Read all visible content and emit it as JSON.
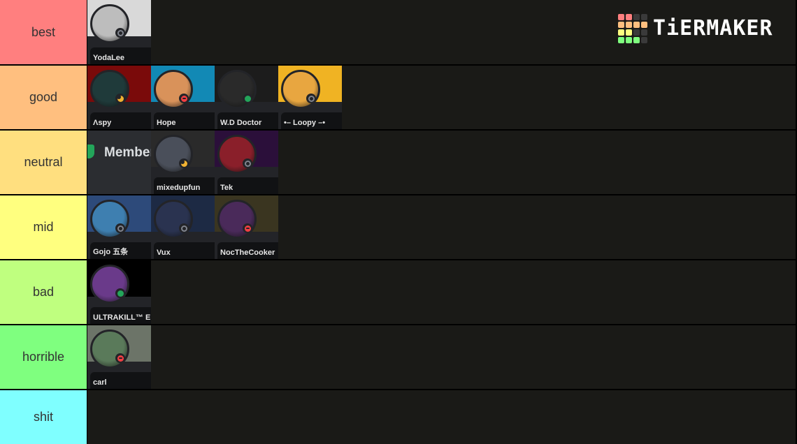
{
  "logo": {
    "text": "TiERMAKER",
    "grid_colors": [
      "#ff7f7f",
      "#ff7f7f",
      "#3a3a3a",
      "#3a3a3a",
      "#ffbf7f",
      "#ffbf7f",
      "#ffbf7f",
      "#ffbf7f",
      "#ffff7f",
      "#ffff7f",
      "#3a3a3a",
      "#3a3a3a",
      "#7fff7f",
      "#7fff7f",
      "#7fff7f",
      "#3a3a3a"
    ]
  },
  "tiers": [
    {
      "label": "best",
      "color": "#ff7f7f",
      "items": [
        {
          "name": "YodaLee",
          "status": "offline",
          "banner": "#d9d9d9",
          "avatar": "#bdbdbd"
        }
      ]
    },
    {
      "label": "good",
      "color": "#ffbf7f",
      "items": [
        {
          "name": "Λspy",
          "status": "idle",
          "banner": "#7a0a0a",
          "avatar": "#1f3a3a"
        },
        {
          "name": "Hope",
          "status": "dnd",
          "banner": "#1289b5",
          "avatar": "#d9925a"
        },
        {
          "name": "W.D Doctor",
          "status": "online",
          "banner": "#1c1c1c",
          "avatar": "#2a2a2a"
        },
        {
          "name": "•– Loopy –•",
          "status": "offline",
          "banner": "#f0b323",
          "avatar": "#e8a640"
        }
      ]
    },
    {
      "label": "neutral",
      "color": "#ffdf7f",
      "member_label": "Member",
      "items": [
        {
          "name": "mixedupfun",
          "status": "idle",
          "banner": "#2a2a2a",
          "avatar": "#4a4f5a"
        },
        {
          "name": "Tek",
          "status": "offline",
          "banner": "#2b0f3a",
          "avatar": "#8a1f2a"
        }
      ]
    },
    {
      "label": "mid",
      "color": "#ffff7f",
      "items": [
        {
          "name": "Gojo 五条",
          "status": "offline",
          "banner": "#2d4a7a",
          "avatar": "#3e7fb0"
        },
        {
          "name": "Vux",
          "status": "offline",
          "banner": "#1d2a44",
          "avatar": "#2a3350"
        },
        {
          "name": "NocTheCooker",
          "status": "dnd",
          "banner": "#3a3520",
          "avatar": "#4a2a5a"
        }
      ]
    },
    {
      "label": "bad",
      "color": "#bfff7f",
      "items": [
        {
          "name": "ULTRAKILL™ Enthusiast",
          "status": "online",
          "banner": "#000000",
          "avatar": "#6a3a8a"
        }
      ]
    },
    {
      "label": "horrible",
      "color": "#7fff7f",
      "items": [
        {
          "name": "carl",
          "status": "dnd",
          "banner": "#6c7468",
          "avatar": "#5a7a5a"
        }
      ]
    },
    {
      "label": "shit",
      "color": "#7fffff",
      "items": []
    }
  ]
}
